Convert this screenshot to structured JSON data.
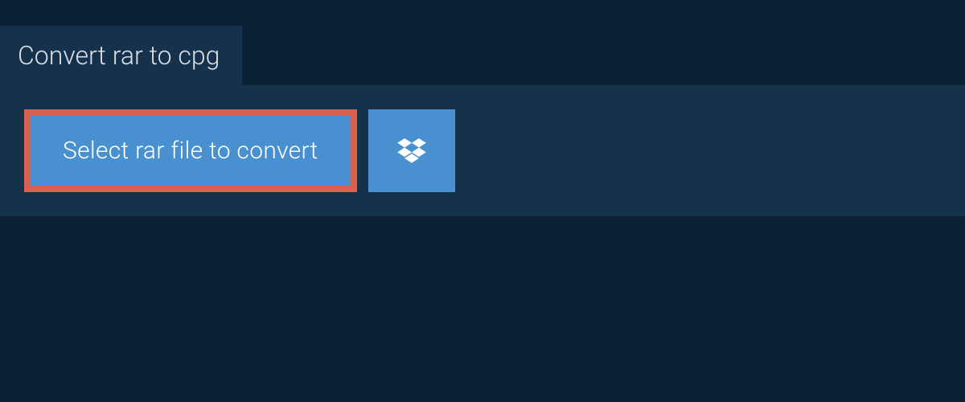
{
  "tab": {
    "title": "Convert rar to cpg"
  },
  "actions": {
    "select_file_label": "Select rar file to convert"
  },
  "colors": {
    "page_bg": "#0a2033",
    "panel_bg": "#15314b",
    "button_bg": "#4990d0",
    "highlight_border": "#d9614f",
    "text_light": "#ffffff",
    "text_muted": "#d8dfe5"
  }
}
